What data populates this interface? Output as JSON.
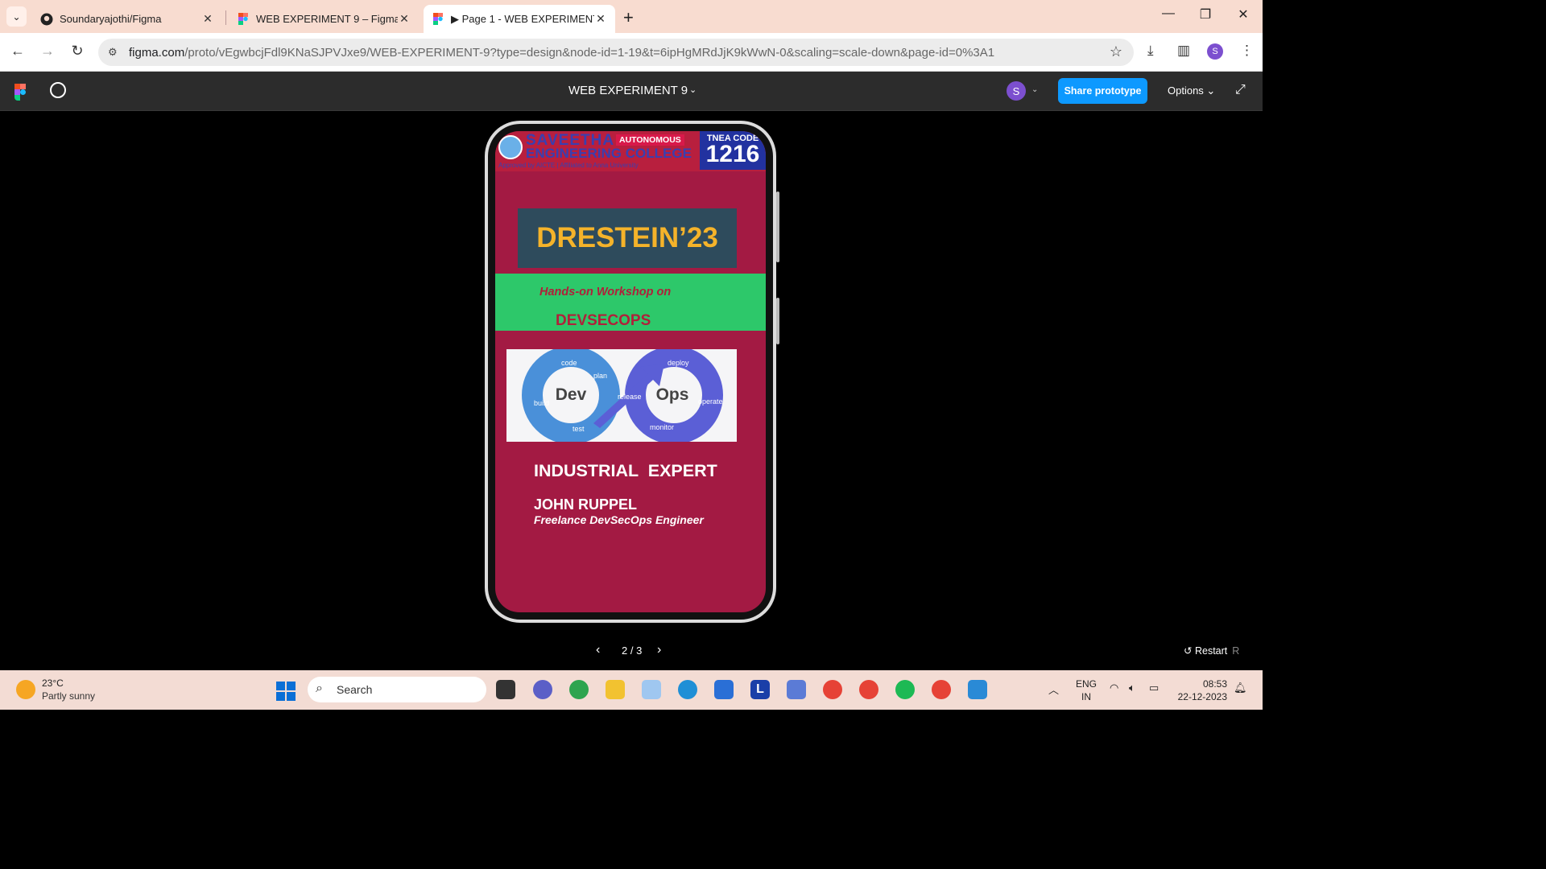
{
  "browser": {
    "tabs": [
      {
        "title": "Soundaryajothi/Figma",
        "icon": "github-icon"
      },
      {
        "title": "WEB EXPERIMENT 9 – Figma",
        "icon": "figma-icon"
      },
      {
        "title": "▶ Page 1 - WEB EXPERIMENT 9",
        "icon": "figma-icon",
        "active": true
      }
    ],
    "url_host": "figma.com",
    "url_path": "/proto/vEgwbcjFdl9KNaSJPVJxe9/WEB-EXPERIMENT-9?type=design&node-id=1-19&t=6ipHgMRdJjK9kWwN-0&scaling=scale-down&page-id=0%3A1",
    "profile_initial": "S"
  },
  "figma": {
    "file_title": "WEB EXPERIMENT 9",
    "user_initial": "S",
    "share_label": "Share prototype",
    "options_label": "Options",
    "pager": "2 / 3",
    "restart_label": "Restart",
    "restart_key": "R"
  },
  "frame": {
    "college_line1": "SAVEETHA",
    "college_line2": "ENGINEERING COLLEGE",
    "college_approved": "Approved by AICTE | Affiliated to Anna University",
    "autonomous": "AUTONOMOUS",
    "tnea_label": "TNEA CODE",
    "tnea_code": "1216",
    "event_title": "DRESTEIN’23",
    "workshop_sub": "Hands-on Workshop on",
    "workshop_title": "DEVSECOPS",
    "devops_left": "Dev",
    "devops_right": "Ops",
    "devops_steps": [
      "code",
      "plan",
      "build",
      "test",
      "release",
      "deploy",
      "operate",
      "monitor"
    ],
    "expert_heading": "INDUSTRIAL  EXPERT",
    "expert_name": "JOHN RUPPEL",
    "expert_role": "Freelance DevSecOps Engineer",
    "colors": {
      "background": "#a31a43",
      "title_box": "#2e4b5c",
      "title_text": "#f5b32a",
      "band": "#2dc86a",
      "band_text": "#b0203a"
    }
  },
  "taskbar": {
    "temperature": "23°C",
    "weather": "Partly sunny",
    "search_placeholder": "Search",
    "lang_line1": "ENG",
    "lang_line2": "IN",
    "time": "08:53",
    "date": "22-12-2023"
  }
}
